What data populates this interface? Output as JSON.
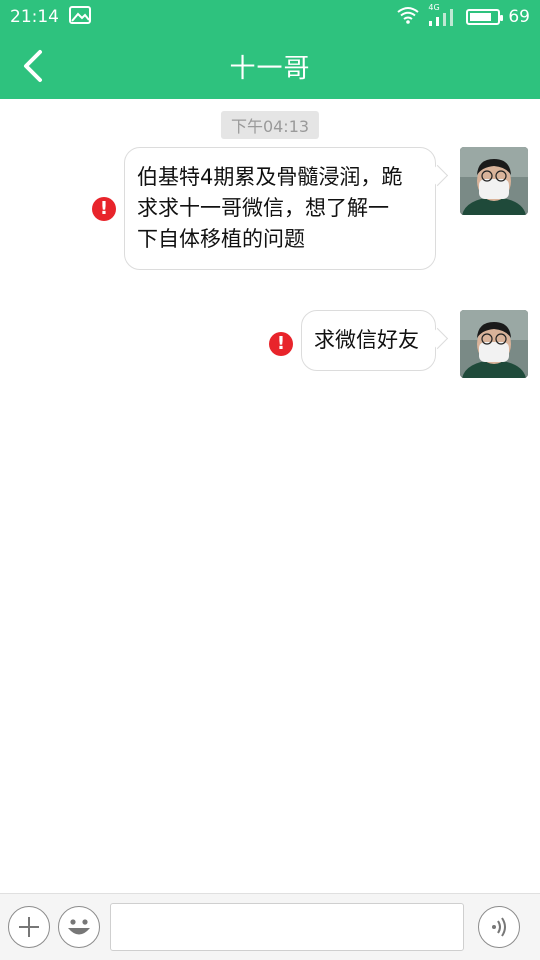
{
  "status_bar": {
    "time": "21:14",
    "battery_percent": "69",
    "network_label": "4G"
  },
  "header": {
    "title": "十一哥",
    "back_icon": "chevron-left-icon"
  },
  "chat": {
    "timestamp": "下午04:13",
    "messages": [
      {
        "text": "伯基特4期累及骨髓浸润，跪\n求求十一哥微信，想了解一\n下自体移植的问题",
        "status": "failed",
        "side": "right"
      },
      {
        "text": "求微信好友",
        "status": "failed",
        "side": "right"
      }
    ]
  },
  "input_bar": {
    "plus_icon": "plus-icon",
    "emoji_icon": "emoji-icon",
    "voice_icon": "voice-icon",
    "input_value": "",
    "input_placeholder": ""
  },
  "colors": {
    "accent": "#2ec27e",
    "error": "#e8242b"
  }
}
